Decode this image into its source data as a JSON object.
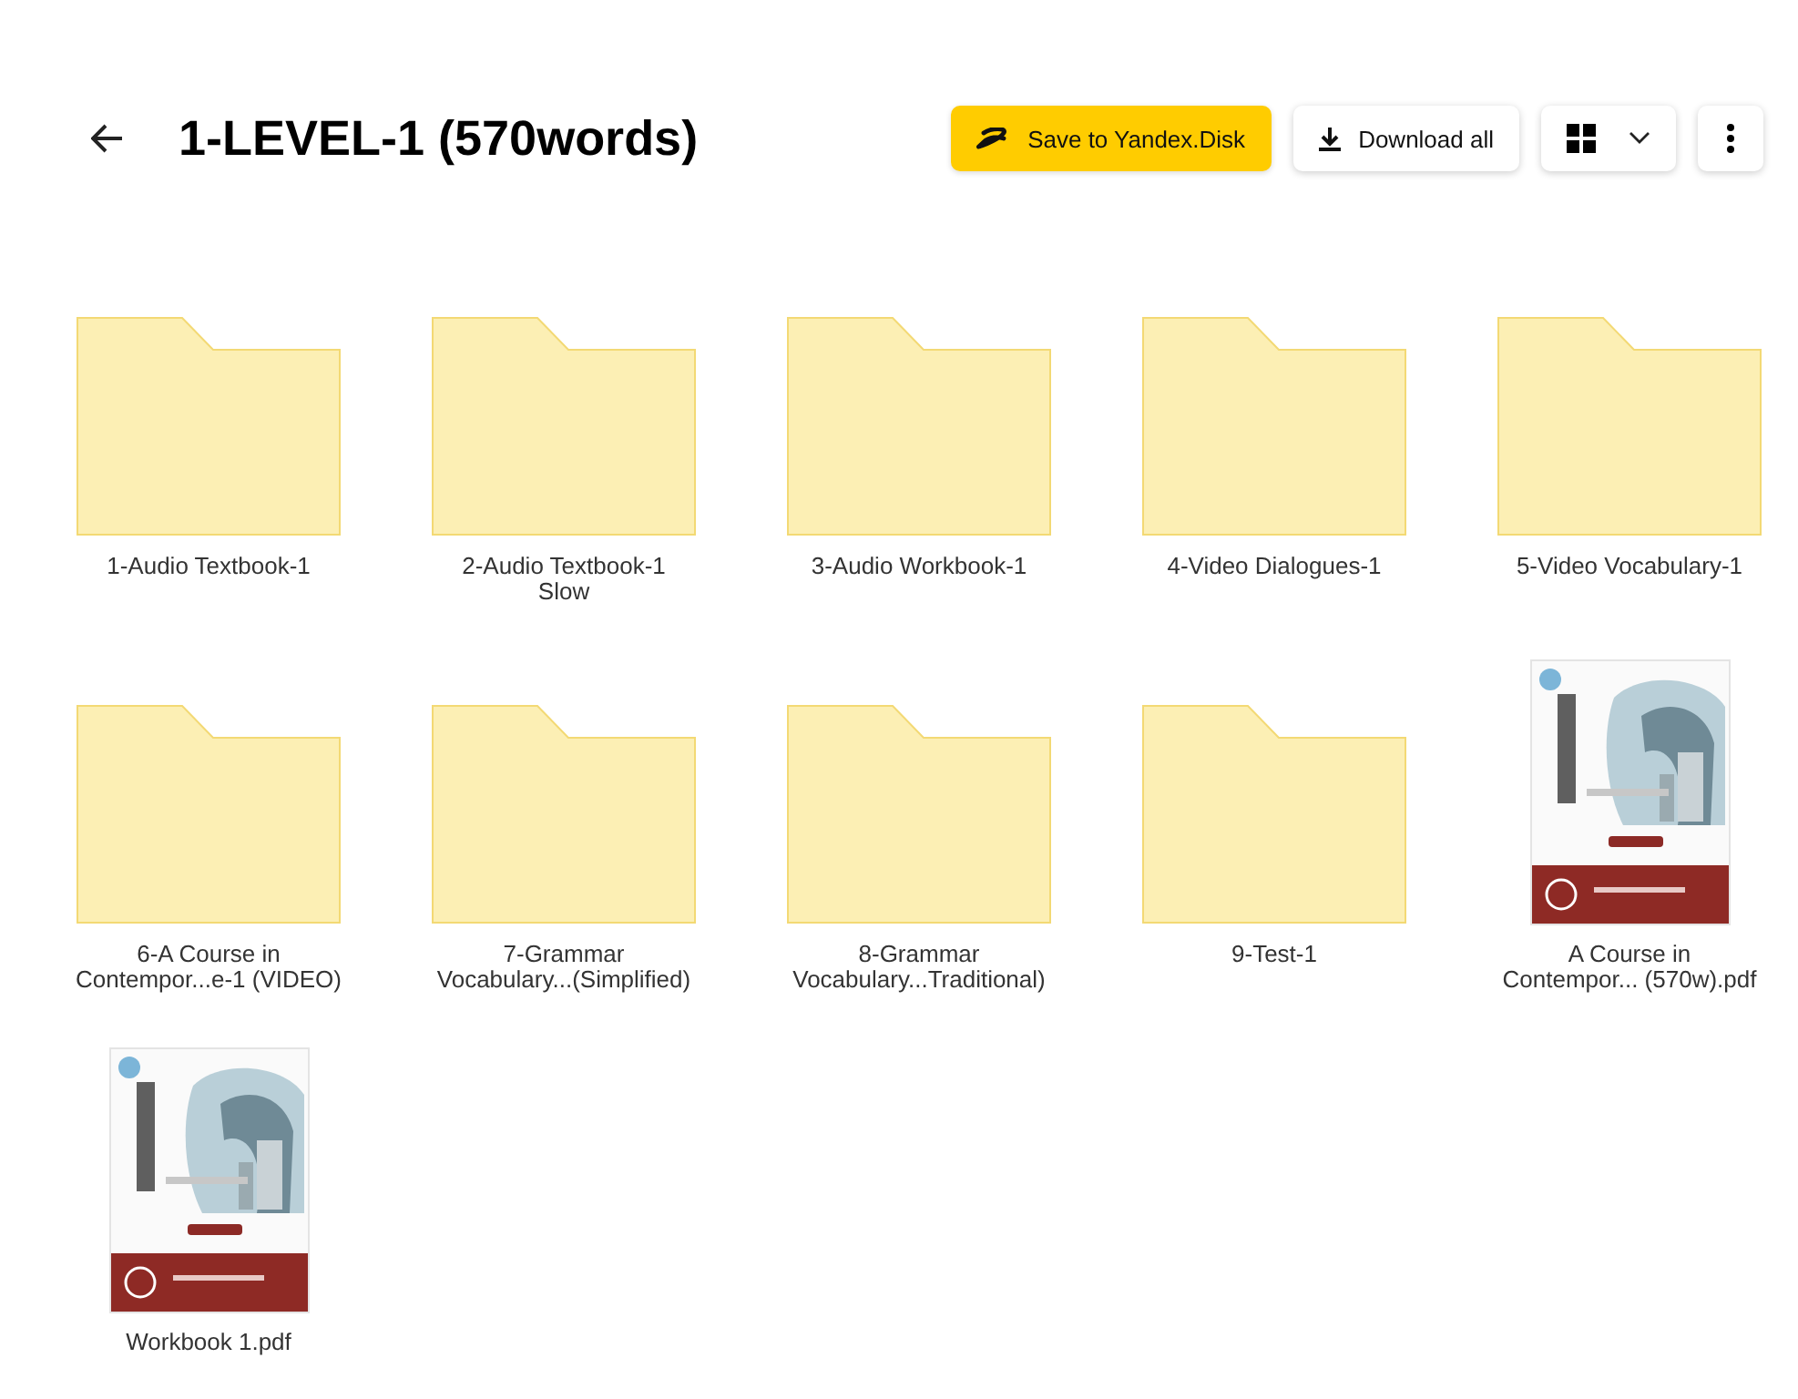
{
  "title": "1-LEVEL-1 (570words)",
  "buttons": [
    {
      "kind": "save",
      "label": "Save to Yandex.Disk"
    },
    {
      "kind": "download",
      "label": "Download all"
    },
    {
      "kind": "view"
    },
    {
      "kind": "more"
    }
  ],
  "items": [
    {
      "kind": "folder",
      "name": "1-Audio Textbook-1"
    },
    {
      "kind": "folder",
      "name": "2-Audio Textbook-1\nSlow"
    },
    {
      "kind": "folder",
      "name": "3-Audio Workbook-1"
    },
    {
      "kind": "folder",
      "name": "4-Video Dialogues-1"
    },
    {
      "kind": "folder",
      "name": "5-Video Vocabulary-1"
    },
    {
      "kind": "folder",
      "name": "6-A Course in\nContempor...e-1 (VIDEO)"
    },
    {
      "kind": "folder",
      "name": "7-Grammar\nVocabulary...(Simplified)"
    },
    {
      "kind": "folder",
      "name": "8-Grammar\nVocabulary...Traditional)"
    },
    {
      "kind": "folder",
      "name": "9-Test-1"
    },
    {
      "kind": "pdf",
      "name": "A Course in\nContempor... (570w).pdf"
    },
    {
      "kind": "pdf",
      "name": "Workbook 1.pdf"
    }
  ]
}
